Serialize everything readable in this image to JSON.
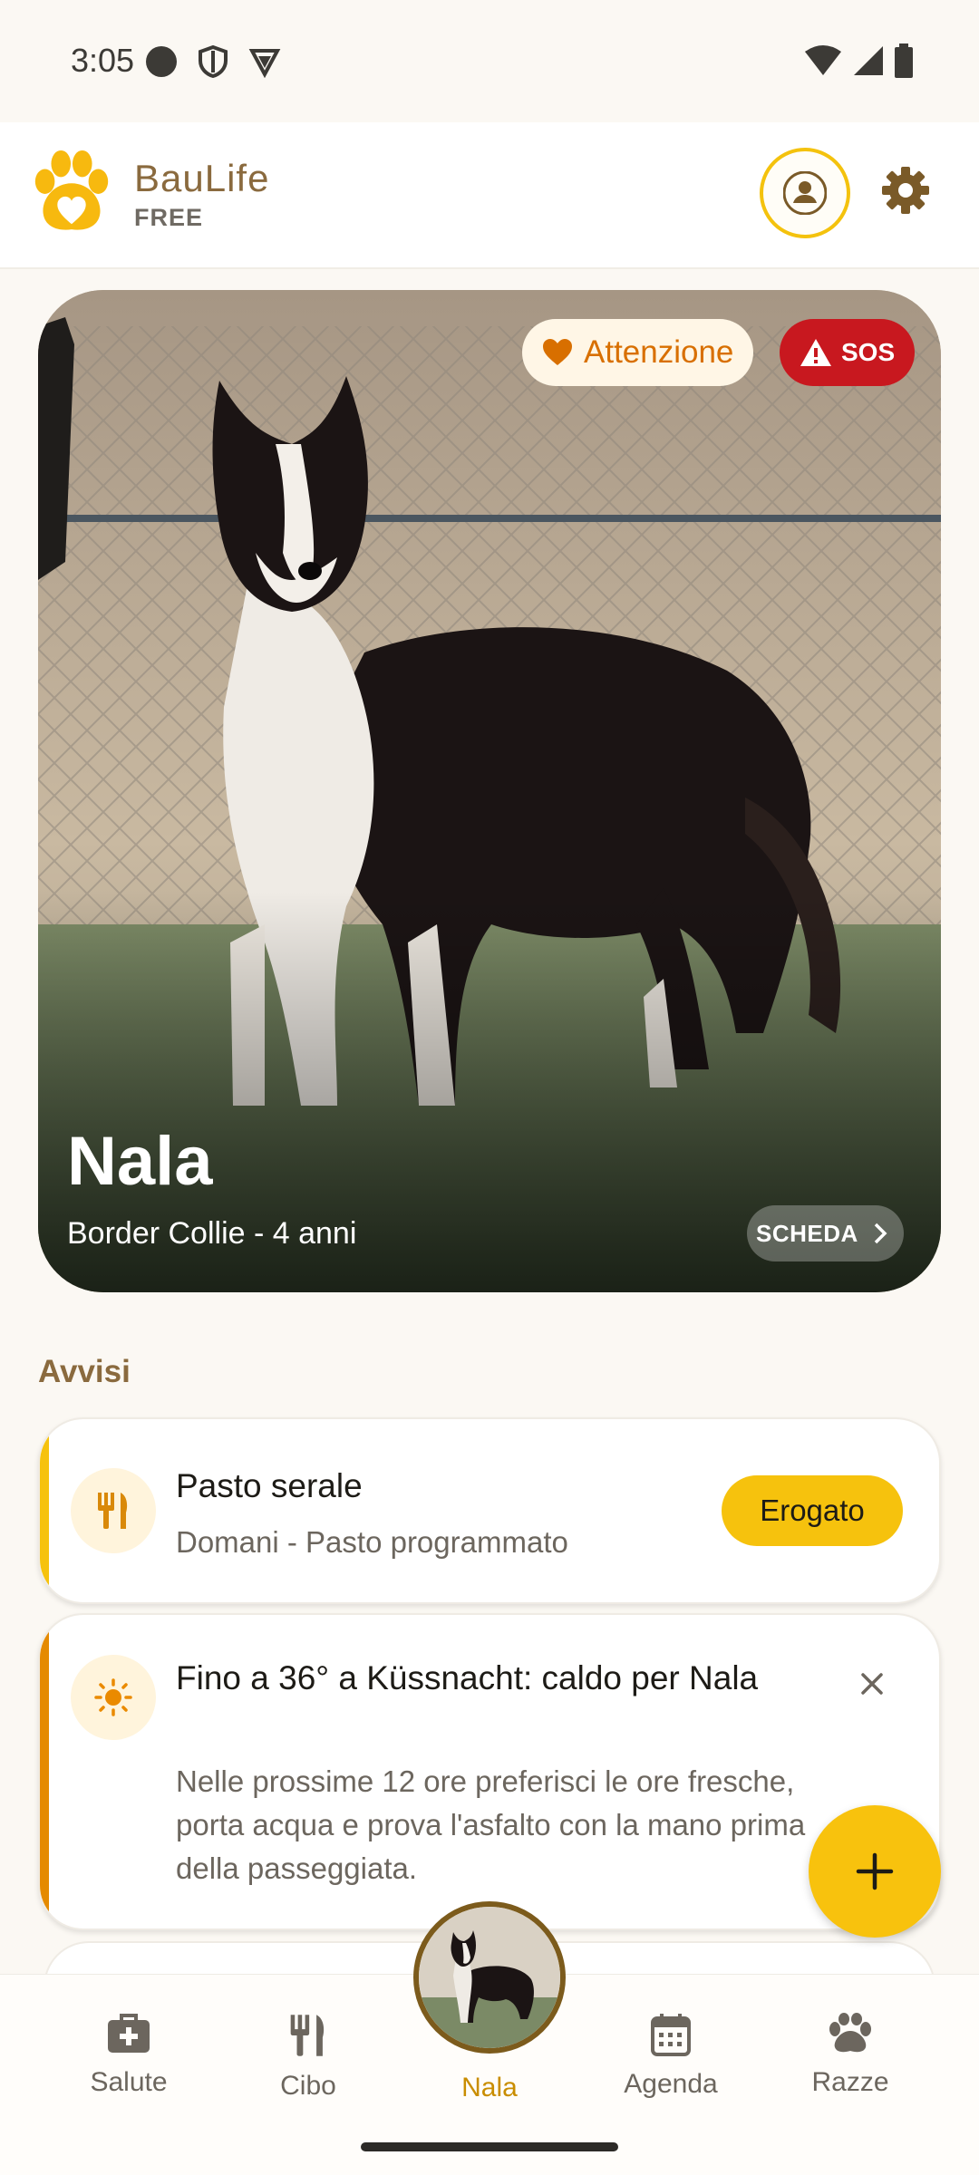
{
  "status_bar": {
    "time": "3:05",
    "icons_left": [
      "circle-icon",
      "shield-icon",
      "vpn-icon"
    ],
    "icons_right": [
      "wifi-icon",
      "signal-icon",
      "battery-icon"
    ]
  },
  "header": {
    "app_name": "BauLife",
    "tier": "FREE",
    "logo_icon": "paw-heart-icon",
    "profile_icon": "person-icon",
    "settings_icon": "gear-icon"
  },
  "hero": {
    "badge_attention": "Attenzione",
    "badge_sos": "SOS",
    "pet_name": "Nala",
    "pet_subtitle": "Border Collie - 4 anni",
    "details_label": "SCHEDA"
  },
  "alerts": {
    "section_title": "Avvisi",
    "items": [
      {
        "title": "Pasto serale",
        "text": "Domani - Pasto programmato",
        "action_label": "Erogato",
        "icon": "utensils-icon",
        "accent": "#f6c20d"
      },
      {
        "title": "Fino a 36° a Küssnacht: caldo per Nala",
        "text": "Nelle prossime 12 ore preferisci le ore fresche, porta acqua e prova l'asfalto con la mano prima della passeggiata.",
        "icon": "sun-icon",
        "accent": "#e58a00"
      }
    ]
  },
  "fab": {
    "icon": "plus-icon"
  },
  "bottom_nav": {
    "items": [
      {
        "label": "Salute",
        "icon": "medkit-icon"
      },
      {
        "label": "Cibo",
        "icon": "utensils-icon"
      },
      {
        "label": "Nala",
        "icon": "pet-avatar"
      },
      {
        "label": "Agenda",
        "icon": "calendar-icon"
      },
      {
        "label": "Razze",
        "icon": "paw-icon"
      }
    ],
    "active": "Nala"
  },
  "colors": {
    "accent_yellow": "#f6c20d",
    "brand_brown": "#8a6a3e",
    "sos_red": "#c8181f",
    "attention_orange": "#d86f00"
  }
}
